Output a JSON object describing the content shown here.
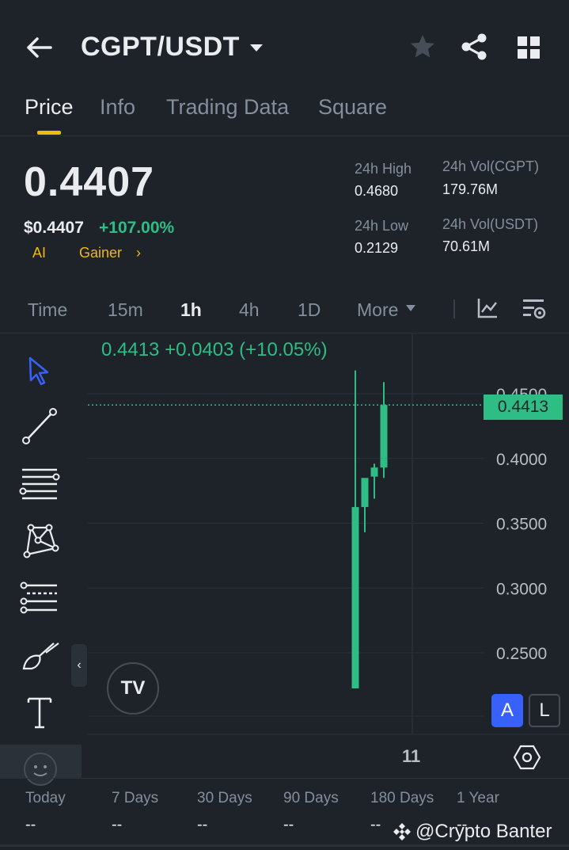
{
  "header": {
    "pair": "CGPT/USDT"
  },
  "tabs": [
    {
      "label": "Price"
    },
    {
      "label": "Info"
    },
    {
      "label": "Trading Data"
    },
    {
      "label": "Square"
    }
  ],
  "ticker": {
    "last_price": "0.4407",
    "usd_price": "$0.4407",
    "change_pct": "+107.00%",
    "tags": [
      "AI",
      "Gainer"
    ],
    "stats": {
      "high_label": "24h High",
      "high_value": "0.4680",
      "low_label": "24h Low",
      "low_value": "0.2129",
      "vol_base_label": "24h Vol(CGPT)",
      "vol_base_value": "179.76M",
      "vol_quote_label": "24h Vol(USDT)",
      "vol_quote_value": "70.61M"
    }
  },
  "timeframes": [
    {
      "label": "Time"
    },
    {
      "label": "15m"
    },
    {
      "label": "1h"
    },
    {
      "label": "4h"
    },
    {
      "label": "1D"
    },
    {
      "label": "More"
    }
  ],
  "chart": {
    "ohlc_line": "0.4413  +0.0403 (+10.05%)",
    "last_price_badge": "0.4413",
    "x_tick": "11",
    "btn_a": "A",
    "btn_l": "L",
    "logo_text": "TV"
  },
  "chart_data": {
    "type": "candlestick",
    "y_ticks": [
      "0.4500",
      "0.4000",
      "0.3500",
      "0.3000",
      "0.2500"
    ],
    "y_tick_values": [
      0.45,
      0.4,
      0.35,
      0.3,
      0.25
    ],
    "ylim": [
      0.2175,
      0.486
    ],
    "last_price": 0.4413,
    "candles": [
      {
        "open": 0.2225,
        "high": 0.468,
        "low": 0.2225,
        "close": 0.3625
      },
      {
        "open": 0.3625,
        "high": 0.37,
        "low": 0.343,
        "close": 0.385
      },
      {
        "open": 0.386,
        "high": 0.396,
        "low": 0.369,
        "close": 0.393
      },
      {
        "open": 0.393,
        "high": 0.43,
        "low": 0.385,
        "close": 0.4
      },
      {
        "open": 0.4,
        "high": 0.459,
        "low": 0.399,
        "close": 0.4413
      }
    ],
    "colors": {
      "up": "#2ebd85",
      "down": "#f6465d"
    }
  },
  "performance": [
    {
      "label": "Today",
      "value": "--"
    },
    {
      "label": "7 Days",
      "value": "--"
    },
    {
      "label": "30 Days",
      "value": "--"
    },
    {
      "label": "90 Days",
      "value": "--"
    },
    {
      "label": "180 Days",
      "value": "--"
    },
    {
      "label": "1 Year",
      "value": "--"
    }
  ],
  "watermark": "@Crypto Banter",
  "colors": {
    "background": "#1e2329",
    "accent": "#f0b90b",
    "up": "#2ebd85",
    "selected_tool": "#3861fb"
  }
}
